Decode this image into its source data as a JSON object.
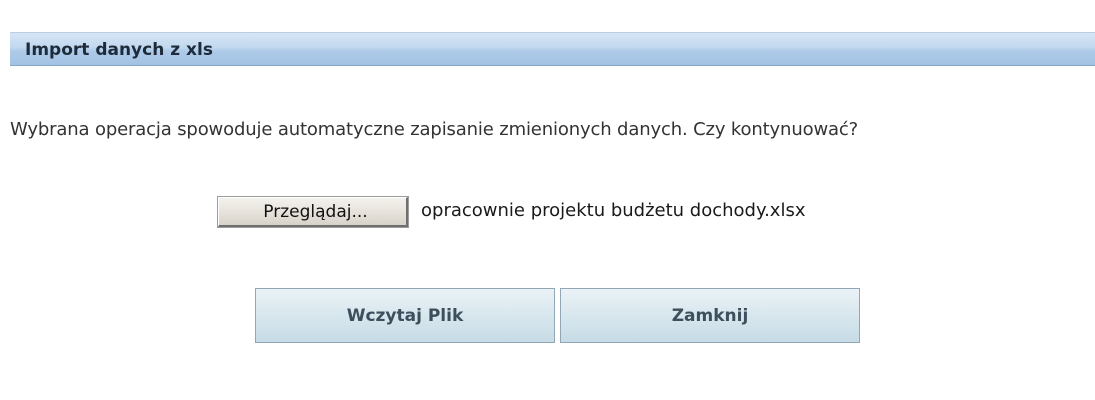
{
  "dialog": {
    "title": "Import danych z xls",
    "message": "Wybrana operacja spowoduje automatyczne zapisanie zmienionych danych. Czy kontynuować?",
    "file_input": {
      "browse_label": "Przeglądaj...",
      "file_name": "opracownie projektu budżetu dochody.xlsx"
    },
    "buttons": {
      "load_label": "Wczytaj Plik",
      "close_label": "Zamknij"
    }
  }
}
